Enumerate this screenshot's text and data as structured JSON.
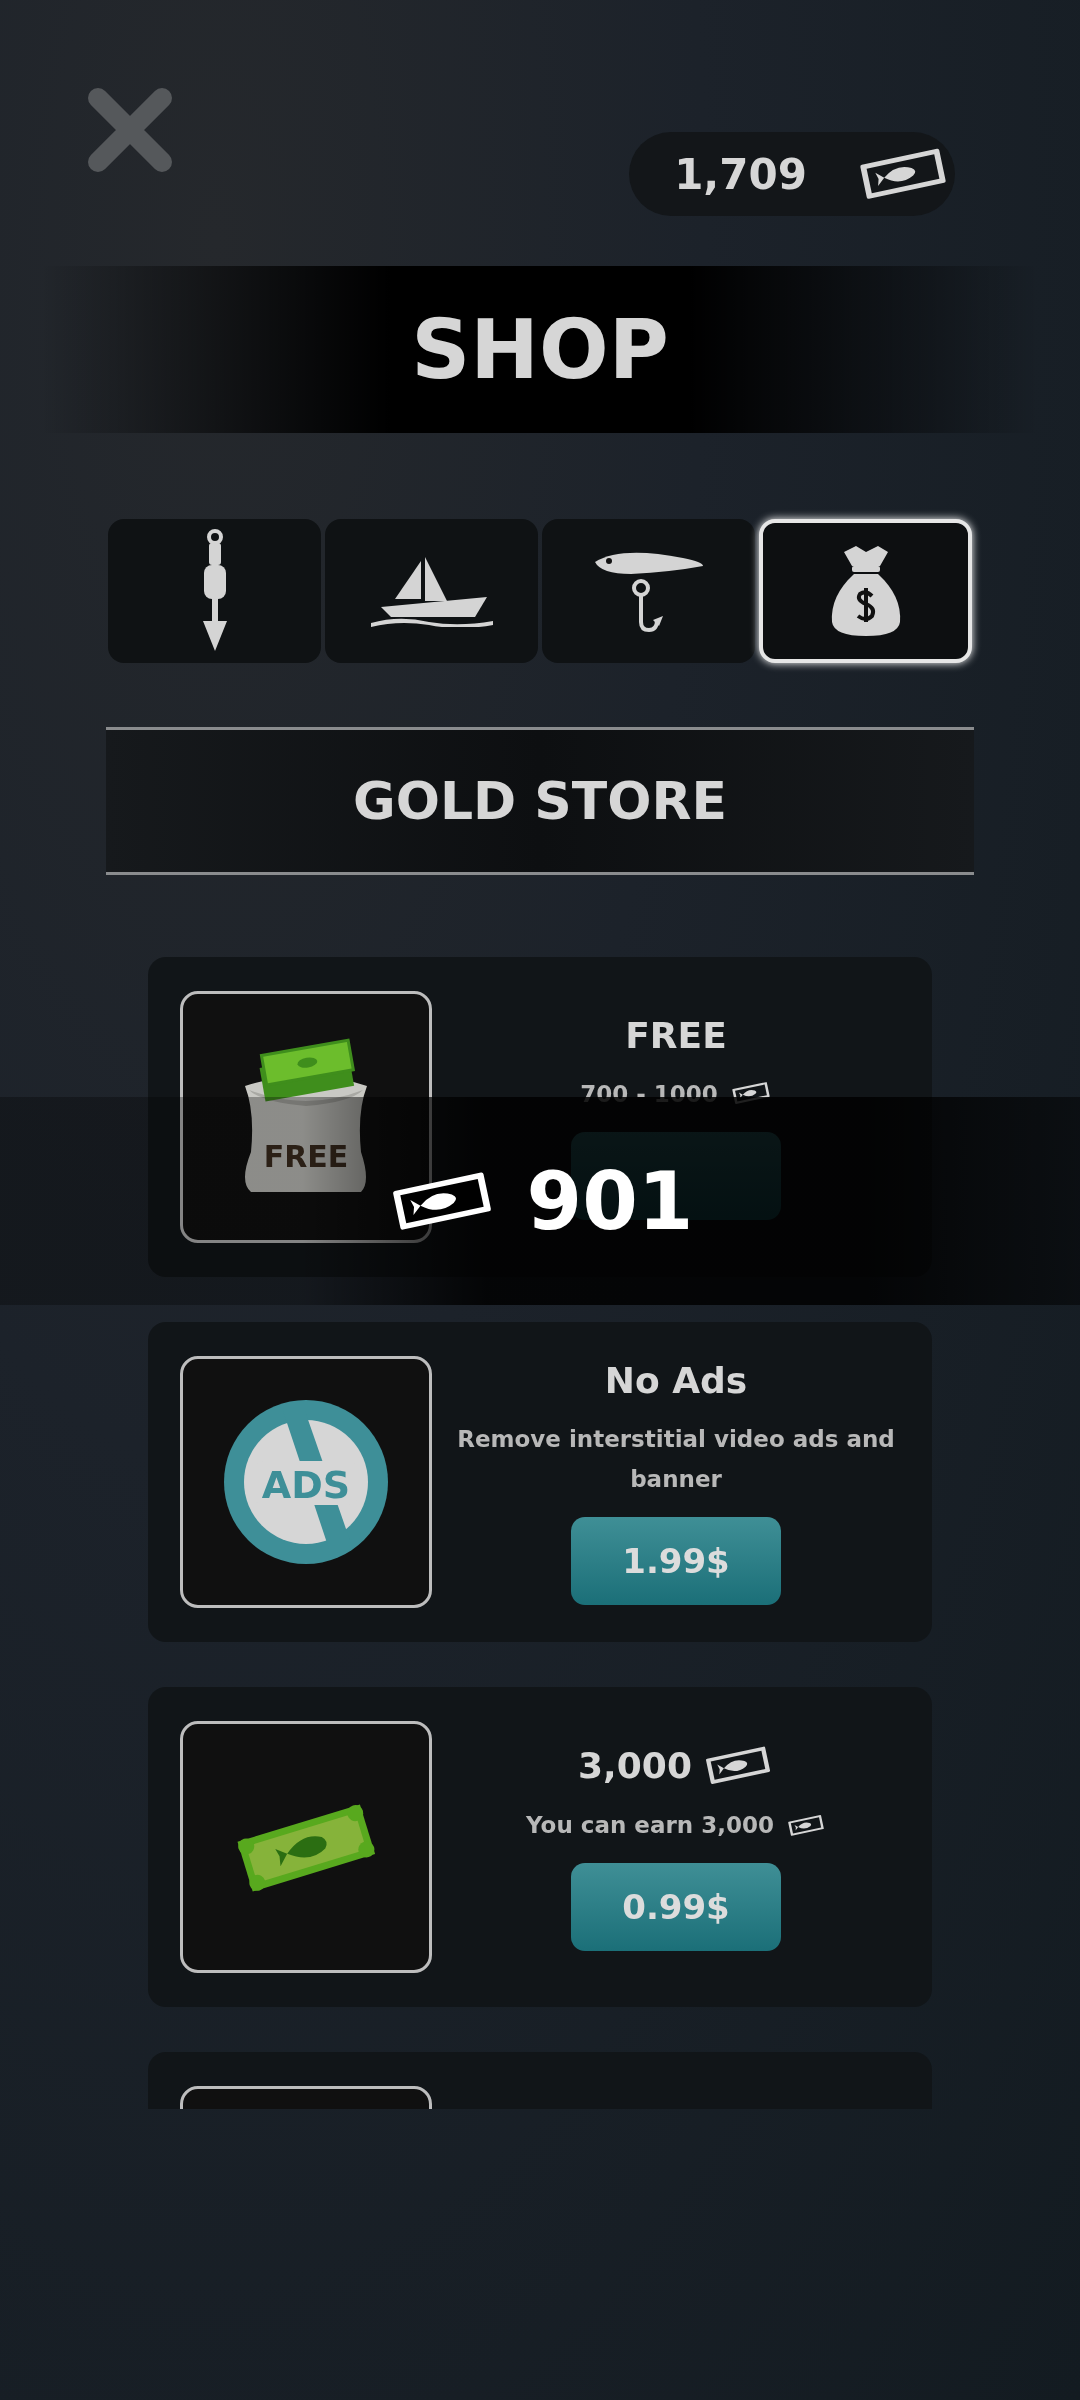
{
  "balance": {
    "amount": "1,709"
  },
  "title": "SHOP",
  "tabs": [
    {
      "kind": "anchor",
      "selected": false
    },
    {
      "kind": "boat",
      "selected": false
    },
    {
      "kind": "lure",
      "selected": false
    },
    {
      "kind": "money_bag",
      "selected": true
    }
  ],
  "section_title": "GOLD STORE",
  "items": [
    {
      "kind": "free",
      "image_text": "FREE",
      "title": "FREE",
      "reward": "700 - 1000"
    },
    {
      "kind": "no_ads",
      "image_text": "ADS",
      "title": "No Ads",
      "description": "Remove interstitial video ads and banner",
      "price": "1.99$"
    },
    {
      "kind": "cash",
      "title": "3,000",
      "description": "You can earn 3,000",
      "price": "0.99$"
    },
    {
      "kind": "partial"
    }
  ],
  "toast": {
    "amount": "901"
  }
}
